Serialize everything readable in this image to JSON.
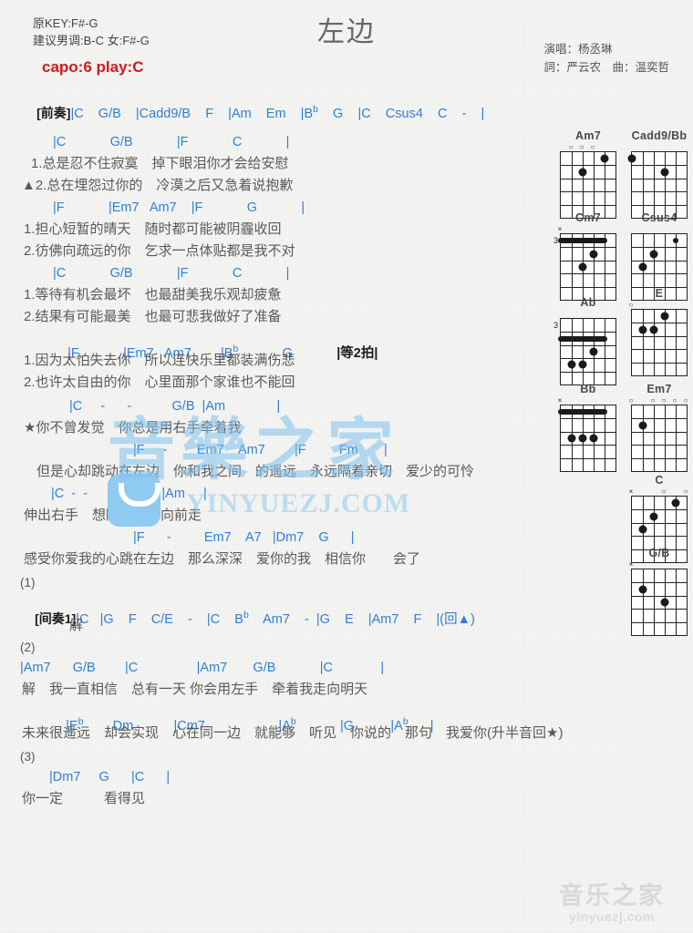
{
  "header": {
    "orig_key": "原KEY:F#-G",
    "suggest_key": "建议男调:B-C 女:F#-G",
    "capo": "capo:6 play:C",
    "title": "左边",
    "singer": "演唱：杨丞琳",
    "writers": "詞：严云农　曲：温奕哲",
    "capo_color": "#d2191b",
    "chord_color": "#2f7fd6"
  },
  "lines": {
    "intro_tag": "[前奏]",
    "intro_chords": "|C    G/B    |Cadd9/B    F    |Am    Em    |B",
    "intro_chords2": "    G    |C    Csus4    C    -    |",
    "v1_c1": "|C            G/B            |F            C            |",
    "v1_l1": "1.总是忍不住寂寞　掉下眼泪你才会给安慰",
    "v1_l2": "▲2.总在埋怨过你的　冷漠之后又急着说抱歉",
    "v1_c2": "|F            |Em7   Am7    |F            G            |",
    "v1_l3": "1.担心短暂的晴天　随时都可能被阴霾收回",
    "v1_l4": "2.彷佛向疏远的你　乞求一点体贴都是我不对",
    "v1_c3": "|C            G/B            |F            C            |",
    "v1_l5": "1.等待有机会最坏　也最甜美我乐观却疲惫",
    "v1_l6": "2.结果有可能最美　也最可悲我做好了准备",
    "v1_c4": "|F            |Em7   Am7        |B",
    "v1_c4b": "            G            ",
    "v1_c4c": "|等2拍|",
    "v1_l7": "1.因为太怕失去你　所以连快乐里都装满伤悲",
    "v1_l8": "2.也许太自由的你　心里面那个家谁也不能回",
    "ch_c1": "|C     -      -           G/B  |Am              |",
    "ch_l1": "★你不曾发觉　你总是用右手牵着我",
    "ch_c2": "|F     -        Em7    Am7        |F         Fm       |",
    "ch_l2": "但是心却跳动在左边　你和我之间　的遥远　永远隔着亲切　爱少的可怜",
    "ch_c3": "|C  -  -      G/B        |Am     |",
    "ch_l3": "伸出右手　想陪着你　向前走",
    "ch_c4": "|F      -         Em7    A7   |Dm7    G      |",
    "ch_l4": "感受你爱我的心跳在左边　那么深深　爱你的我　相信你　　会了",
    "mark1": "(1)",
    "inter_tag": "[间奏1]",
    "inter_chords": "|C   |G    F    C/E    -    |C    B",
    "inter_chords2": "    Am7    -  |G    E    |Am7    F    |(回▲)",
    "inter_lyric": "解",
    "mark2": "(2)",
    "v2_c1": "|Am7      G/B        |C                |Am7       G/B            |C             |",
    "v2_l1": "解　我一直相信　总有一天 你会用左手　牵着我走向明天",
    "v2_c2": "|E",
    "v2_c2b": "        Dm           |Cm7                    |A",
    "v2_c2c": "            |G          |A",
    "v2_c2d": "      |",
    "v2_l2": "未来很遥远　却会实现　心在同一边　就能够　听见　你说的　那句　我爱你(升半音回★)",
    "mark3": "(3)",
    "v3_c1": "|Dm7     G      |C      |",
    "v3_l1": "你一定　　　看得见"
  },
  "diagrams": [
    {
      "name": "Am7",
      "marks": [
        {
          "sym": "o",
          "s": 1
        },
        {
          "sym": "o",
          "s": 2
        },
        {
          "sym": "o",
          "s": 3
        }
      ],
      "dots": [
        {
          "s": 2,
          "f": 2
        },
        {
          "s": 4,
          "f": 1
        }
      ],
      "barre": null,
      "fret": ""
    },
    {
      "name": "Cadd9/Bb",
      "marks": [],
      "dots": [
        {
          "s": 0,
          "f": 1
        },
        {
          "s": 3,
          "f": 2
        }
      ],
      "barre": null,
      "fret": ""
    },
    {
      "name": "Cm7",
      "marks": [
        {
          "sym": "x",
          "s": 0
        }
      ],
      "dots": [
        {
          "s": 2,
          "f": 3
        },
        {
          "s": 3,
          "f": 2
        }
      ],
      "barre": {
        "f": 1,
        "from": 0,
        "to": 4
      },
      "fret": "3"
    },
    {
      "name": "Csus4",
      "marks": [],
      "dots": [
        {
          "s": 2,
          "f": 2
        },
        {
          "s": 1,
          "f": 3
        }
      ],
      "barre": {
        "f": 1,
        "from": 4,
        "to": 4
      },
      "fret": ""
    },
    {
      "name": "Ab",
      "marks": [],
      "dots": [
        {
          "s": 1,
          "f": 4
        },
        {
          "s": 2,
          "f": 4
        },
        {
          "s": 3,
          "f": 3
        }
      ],
      "barre": {
        "f": 2,
        "from": 0,
        "to": 4
      },
      "fret": "3"
    },
    {
      "name": "E",
      "marks": [
        {
          "sym": "o",
          "s": 0
        }
      ],
      "dots": [
        {
          "s": 1,
          "f": 2
        },
        {
          "s": 2,
          "f": 2
        },
        {
          "s": 3,
          "f": 1
        }
      ],
      "barre": null,
      "fret": ""
    },
    {
      "name": "Bb",
      "marks": [
        {
          "sym": "x",
          "s": 0
        }
      ],
      "dots": [
        {
          "s": 1,
          "f": 3
        },
        {
          "s": 2,
          "f": 3
        },
        {
          "s": 3,
          "f": 3
        }
      ],
      "barre": {
        "f": 1,
        "from": 0,
        "to": 4
      },
      "fret": ""
    },
    {
      "name": "Em7",
      "marks": [
        {
          "sym": "o",
          "s": 0
        },
        {
          "sym": "o",
          "s": 2
        },
        {
          "sym": "o",
          "s": 3
        },
        {
          "sym": "o",
          "s": 4
        },
        {
          "sym": "o",
          "s": 5
        }
      ],
      "dots": [
        {
          "s": 1,
          "f": 2
        }
      ],
      "barre": null,
      "fret": ""
    },
    {
      "name": "C",
      "marks": [
        {
          "sym": "x",
          "s": 0
        },
        {
          "sym": "o",
          "s": 3
        },
        {
          "sym": "o",
          "s": 5
        }
      ],
      "dots": [
        {
          "s": 1,
          "f": 3
        },
        {
          "s": 2,
          "f": 2
        },
        {
          "s": 4,
          "f": 1
        }
      ],
      "barre": null,
      "fret": ""
    },
    {
      "name": "G/B",
      "marks": [
        {
          "sym": "x",
          "s": 0
        }
      ],
      "dots": [
        {
          "s": 1,
          "f": 2
        },
        {
          "s": 3,
          "f": 3
        }
      ],
      "barre": null,
      "fret": ""
    }
  ],
  "watermark": {
    "center_cn": "音樂之家",
    "center_en": "YINYUEZJ.COM",
    "corner_cn": "音乐之家",
    "corner_en": "yinyuezj.com"
  }
}
